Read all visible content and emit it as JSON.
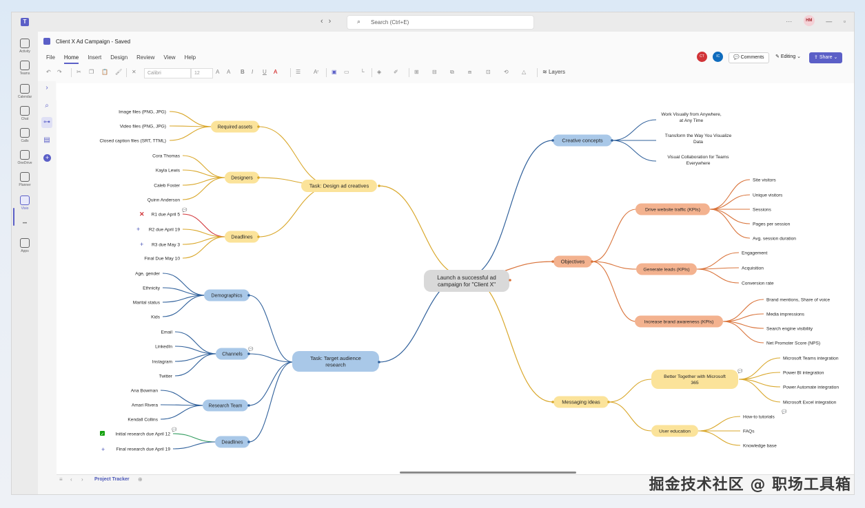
{
  "titlebar": {
    "search_placeholder": "Search (Ctrl+E)",
    "avatar": "HM",
    "more": "···",
    "minimize": "—",
    "restore": "▫"
  },
  "rail": [
    {
      "label": "Activity",
      "icon": "bell-icon"
    },
    {
      "label": "Teams",
      "icon": "teams-icon"
    },
    {
      "label": "Calendar",
      "icon": "calendar-icon"
    },
    {
      "label": "Chat",
      "icon": "chat-icon"
    },
    {
      "label": "Calls",
      "icon": "phone-icon"
    },
    {
      "label": "OneDrive",
      "icon": "cloud-icon"
    },
    {
      "label": "Planner",
      "icon": "planner-icon"
    },
    {
      "label": "Visio",
      "icon": "visio-icon",
      "active": true
    },
    {
      "label": "",
      "icon": "more-icon"
    },
    {
      "label": "Apps",
      "icon": "apps-icon"
    }
  ],
  "app": {
    "title": "Client X Ad Campaign  -  Saved",
    "menu": [
      "File",
      "Home",
      "Insert",
      "Design",
      "Review",
      "View",
      "Help"
    ],
    "active_menu": "Home",
    "collaborators": [
      "CT",
      "IC"
    ],
    "comments": "Comments",
    "editing": "Editing",
    "share": "Share",
    "font_name": "Calibri",
    "font_size": "12",
    "layers": "Layers"
  },
  "mindmap": {
    "center": "Launch a successful ad campaign for \"Client X\"",
    "design_task": "Task: Design ad creatives",
    "required_assets": "Required assets",
    "assets": [
      "Image files (PNG, JPG)",
      "Video files (PNG, JPG)",
      "Closed caption files (SRT, TTML)"
    ],
    "designers": "Designers",
    "designer_names": [
      "Cora Thomas",
      "Kayla Lewis",
      "Caleb Foster",
      "Quinn Anderson"
    ],
    "deadlines": "Deadlines",
    "design_deadlines": [
      "R1 due April 5",
      "R2 due April 19",
      "R3 due May 3",
      "Final Due May 10"
    ],
    "research_task": "Task: Target audience research",
    "demographics": "Demographics",
    "demographic_items": [
      "Age, gender",
      "Ethnicity",
      "Marital status",
      "Kids"
    ],
    "channels": "Channels",
    "channel_items": [
      "Email",
      "LinkedIn",
      "Instagram",
      "Twitter"
    ],
    "research_team": "Research Team",
    "team_members": [
      "Ana Bowman",
      "Amari Rivera",
      "Kendall Collins"
    ],
    "research_deadlines_label": "Deadlines",
    "research_deadlines": [
      "Initial research due April 12",
      "Final research due April 19"
    ],
    "creative_concepts": "Creative concepts",
    "concepts": [
      "Work Visually from Anywhere, at Any Time",
      "Transform the Way You Visualize Data",
      "Visual Collaboration for Teams Everywhere"
    ],
    "objectives": "Objectives",
    "website_traffic": "Drive website traffic (KPIs)",
    "traffic_items": [
      "Site visitors",
      "Unique visitors",
      "Sessions",
      "Pages per session",
      "Avg. session duration"
    ],
    "generate_leads": "Generate leads (KPIs)",
    "lead_items": [
      "Engagement",
      "Acquisition",
      "Conversion rate"
    ],
    "brand_awareness": "Increase brand awareness (KPIs)",
    "brand_items": [
      "Brand mentions, Share of voice",
      "Media impressions",
      "Search engine visibility",
      "Net Promoter Score (NPS)"
    ],
    "messaging": "Messaging ideas",
    "better_together": "Better Together with Microsoft 365",
    "m365_items": [
      "Microsoft Teams integration",
      "Power BI integration",
      "Power Automate integration",
      "Microsoft Excel integration"
    ],
    "user_education": "User education",
    "education_items": [
      "How-to tutorials",
      "FAQs",
      "Knowledge base"
    ]
  },
  "colors": {
    "yellow_node": "#fbe39a",
    "yellow_line": "#d9a72a",
    "blue_node": "#a9c8e8",
    "blue_line": "#2e5f9a",
    "orange_node": "#f3b28f",
    "orange_line": "#d9733a",
    "center_node": "#d9d9d9",
    "accent": "#5b5fc7"
  },
  "bottom": {
    "tab": "Project Tracker"
  },
  "watermark": "掘金技术社区 @ 职场工具箱"
}
